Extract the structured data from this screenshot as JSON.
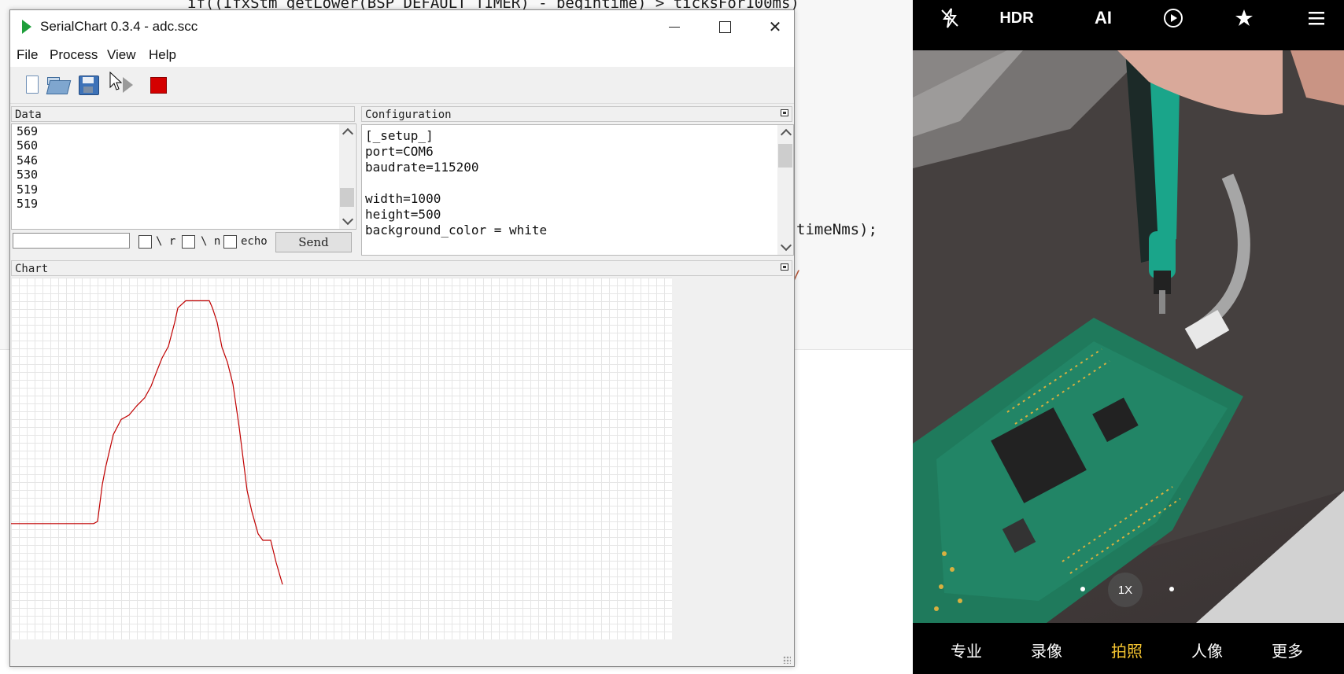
{
  "editor": {
    "code_line_1": "if((IfxStm_getLower(BSP_DEFAULT_TIMER) - begintime) > ticksFor100ms)",
    "code_line_2": "timeNms);",
    "code_line_3": "/"
  },
  "window": {
    "title": "SerialChart 0.3.4 - adc.scc"
  },
  "menu": {
    "file": "File",
    "process": "Process",
    "view": "View",
    "help": "Help"
  },
  "panes": {
    "data": "Data",
    "configuration": "Configuration",
    "chart": "Chart"
  },
  "data_values": [
    "569",
    "560",
    "546",
    "530",
    "519",
    "519"
  ],
  "send_row": {
    "input_value": "",
    "r_label": "\\ r",
    "n_label": "\\ n",
    "echo_label": "echo",
    "send_label": "Send"
  },
  "config_lines": [
    "[_setup_]",
    "port=COM6",
    "baudrate=115200",
    "",
    "width=1000",
    "height=500",
    "background_color = white"
  ],
  "chart_data": {
    "type": "line",
    "color": "#c00000",
    "x": [
      0,
      75,
      105,
      110,
      116,
      120,
      125,
      130,
      140,
      150,
      160,
      170,
      178,
      185,
      192,
      200,
      208,
      212,
      222,
      252,
      256,
      262,
      268,
      275,
      282,
      290,
      300,
      306,
      314,
      320,
      330,
      337,
      345
    ],
    "y": [
      160,
      160,
      160,
      163,
      214,
      237,
      260,
      283,
      304,
      310,
      323,
      334,
      350,
      370,
      389,
      405,
      438,
      458,
      468,
      468,
      458,
      438,
      404,
      383,
      353,
      293,
      206,
      177,
      146,
      137,
      137,
      106,
      76
    ],
    "xlim": [
      0,
      840
    ],
    "ylim": [
      0,
      500
    ],
    "grid": true
  },
  "camera": {
    "top_icons": [
      "flash-off-icon",
      "hdr",
      "ai",
      "live-photo-icon",
      "filter-icon",
      "menu-icon"
    ],
    "hdr_label": "HDR",
    "ai_label": "AI",
    "zoom_label": "1X",
    "modes": [
      "专业",
      "录像",
      "拍照",
      "人像",
      "更多"
    ],
    "active_mode_color": "#f4c430"
  }
}
